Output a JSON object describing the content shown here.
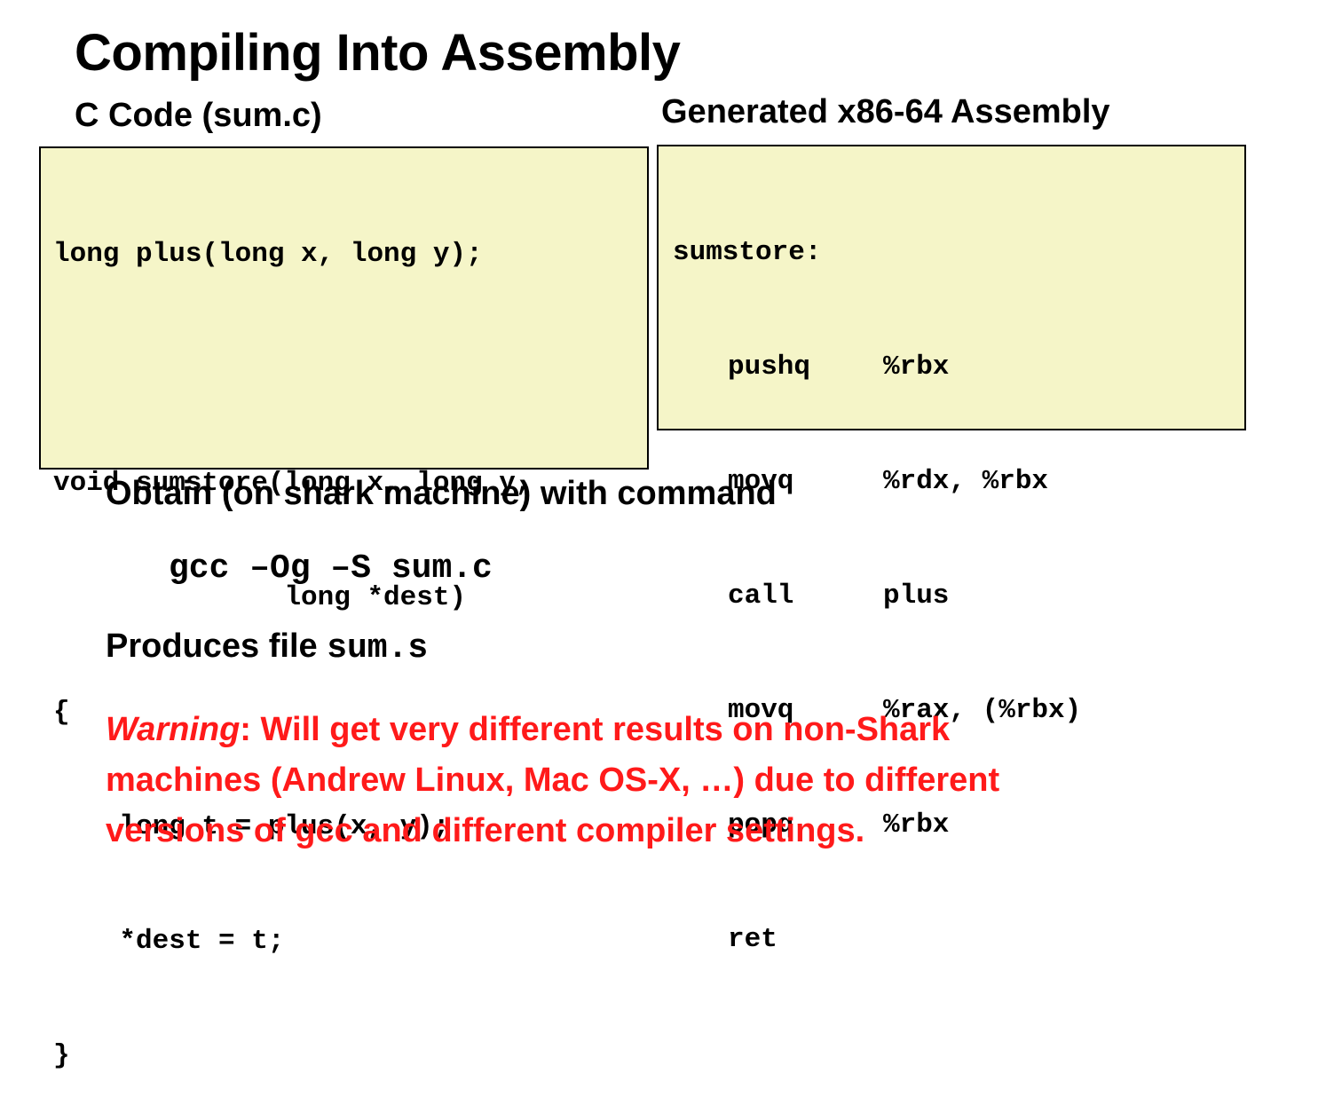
{
  "title": "Compiling Into Assembly",
  "c_section": {
    "label": "C Code (sum.c)",
    "lines": [
      "long plus(long x, long y);",
      "",
      "void sumstore(long x, long y,",
      "              long *dest)",
      "{",
      "    long t = plus(x, y);",
      "    *dest = t;",
      "}"
    ]
  },
  "asm_section": {
    "label": "Generated x86-64 Assembly",
    "func_label": "sumstore:",
    "instructions": [
      {
        "op": "pushq",
        "args": "%rbx"
      },
      {
        "op": "movq",
        "args": "%rdx, %rbx"
      },
      {
        "op": "call",
        "args": "plus"
      },
      {
        "op": "movq",
        "args": "%rax, (%rbx)"
      },
      {
        "op": "popq",
        "args": "%rbx"
      },
      {
        "op": "ret",
        "args": ""
      }
    ]
  },
  "obtain_text": "Obtain (on shark machine) with command",
  "command": "gcc –Og –S sum.c",
  "produces": {
    "prefix": "Produces file ",
    "filename": "sum.s"
  },
  "warning": {
    "label": "Warning",
    "line1": ": Will get very different results on non-Shark",
    "line2": "machines (Andrew Linux, Mac OS-X, …) due to different",
    "line3": "versions of gcc and different compiler settings.",
    "color": "#ff1a1a"
  },
  "colors": {
    "code_background": "#f5f5c8",
    "text": "#000000"
  }
}
